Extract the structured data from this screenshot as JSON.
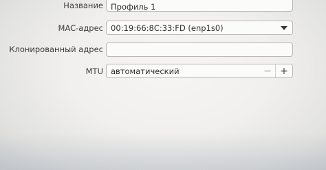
{
  "rows": {
    "name": {
      "label": "Название",
      "value": "Профиль 1"
    },
    "mac": {
      "label": "MAC-адрес",
      "value": "00:19:66:8C:33:FD (enp1s0)",
      "dropdown_icon": "chevron-down-icon"
    },
    "cloned": {
      "label": "Клонированный адрес",
      "value": ""
    },
    "mtu": {
      "label": "MTU",
      "value": "автоматический",
      "minus_label": "−",
      "plus_label": "+"
    }
  }
}
